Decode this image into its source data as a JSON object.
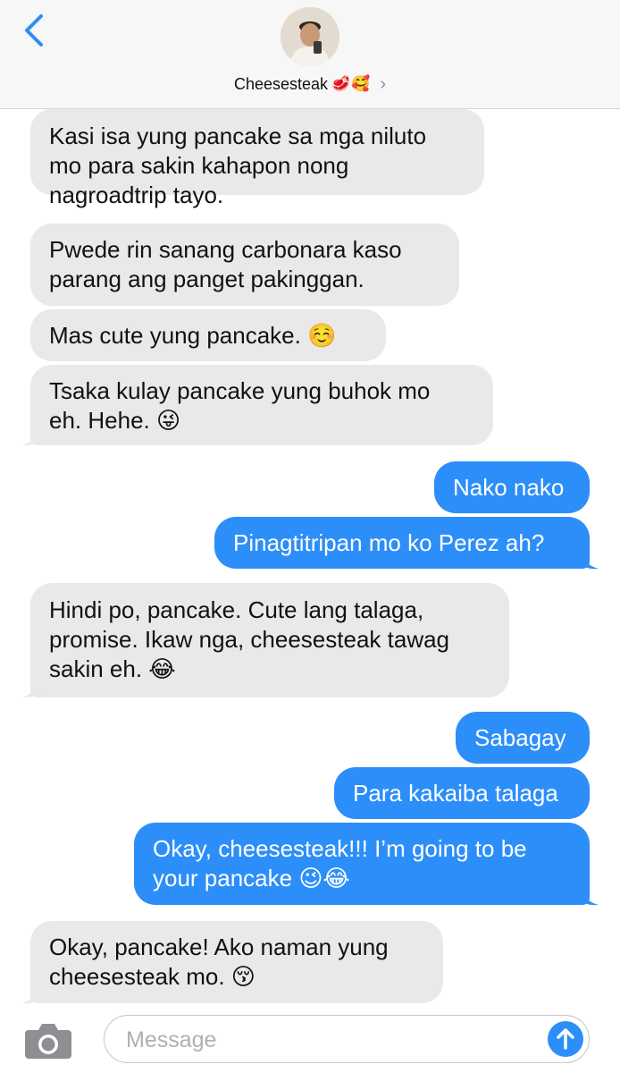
{
  "header": {
    "contact_name": "Cheesesteak",
    "contact_emojis": "🥩🥰",
    "chevron": "›"
  },
  "messages": [
    {
      "side": "in",
      "text": "Kasi isa yung pancake sa mga niluto\nmo para sakin kahapon nong\nnagroadtrip tayo."
    },
    {
      "side": "in",
      "text": "Pwede rin sanang carbonara kaso\nparang ang panget pakinggan."
    },
    {
      "side": "in",
      "text": "Mas cute yung pancake. ☺️"
    },
    {
      "side": "in",
      "text": "Tsaka kulay pancake yung buhok mo\neh. Hehe. 😜"
    },
    {
      "side": "out",
      "text": "Nako nako"
    },
    {
      "side": "out",
      "text": "Pinagtitripan mo ko Perez ah?"
    },
    {
      "side": "in",
      "text": "Hindi po, pancake. Cute lang talaga,\npromise. Ikaw nga, cheesesteak tawag\nsakin eh. 😂"
    },
    {
      "side": "out",
      "text": "Sabagay"
    },
    {
      "side": "out",
      "text": "Para kakaiba talaga"
    },
    {
      "side": "out",
      "text": "Okay, cheesesteak!!! I’m going to be\nyour pancake 😉😂"
    },
    {
      "side": "in",
      "text": "Okay, pancake! Ako naman yung\ncheesesteak mo. 😚"
    }
  ],
  "composer": {
    "placeholder": "Message",
    "icons": {
      "camera": "camera-icon",
      "send": "arrow-up-icon",
      "back": "chevron-left-icon"
    }
  },
  "colors": {
    "incoming_bubble": "#e9e9eb",
    "outgoing_bubble": "#2c8ef8",
    "accent": "#2c8ef8"
  }
}
